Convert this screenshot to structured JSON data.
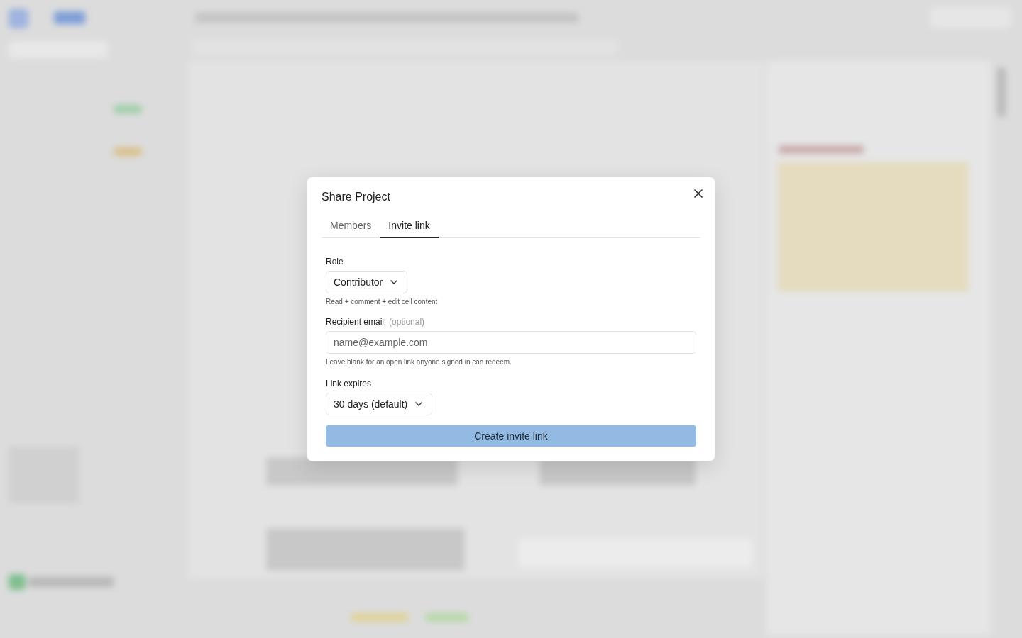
{
  "dialog": {
    "title": "Share Project",
    "tabs": [
      {
        "label": "Members",
        "selected": false
      },
      {
        "label": "Invite link",
        "selected": true
      }
    ],
    "role": {
      "label": "Role",
      "value": "Contributor",
      "hint": "Read + comment + edit cell content"
    },
    "email": {
      "label": "Recipient email",
      "note": "(optional)",
      "placeholder": "name@example.com",
      "hint": "Leave blank for an open link anyone signed in can redeem."
    },
    "expires": {
      "label": "Link expires",
      "value": "30 days (default)"
    },
    "submit": {
      "label": "Create invite link",
      "disabled": true
    }
  }
}
